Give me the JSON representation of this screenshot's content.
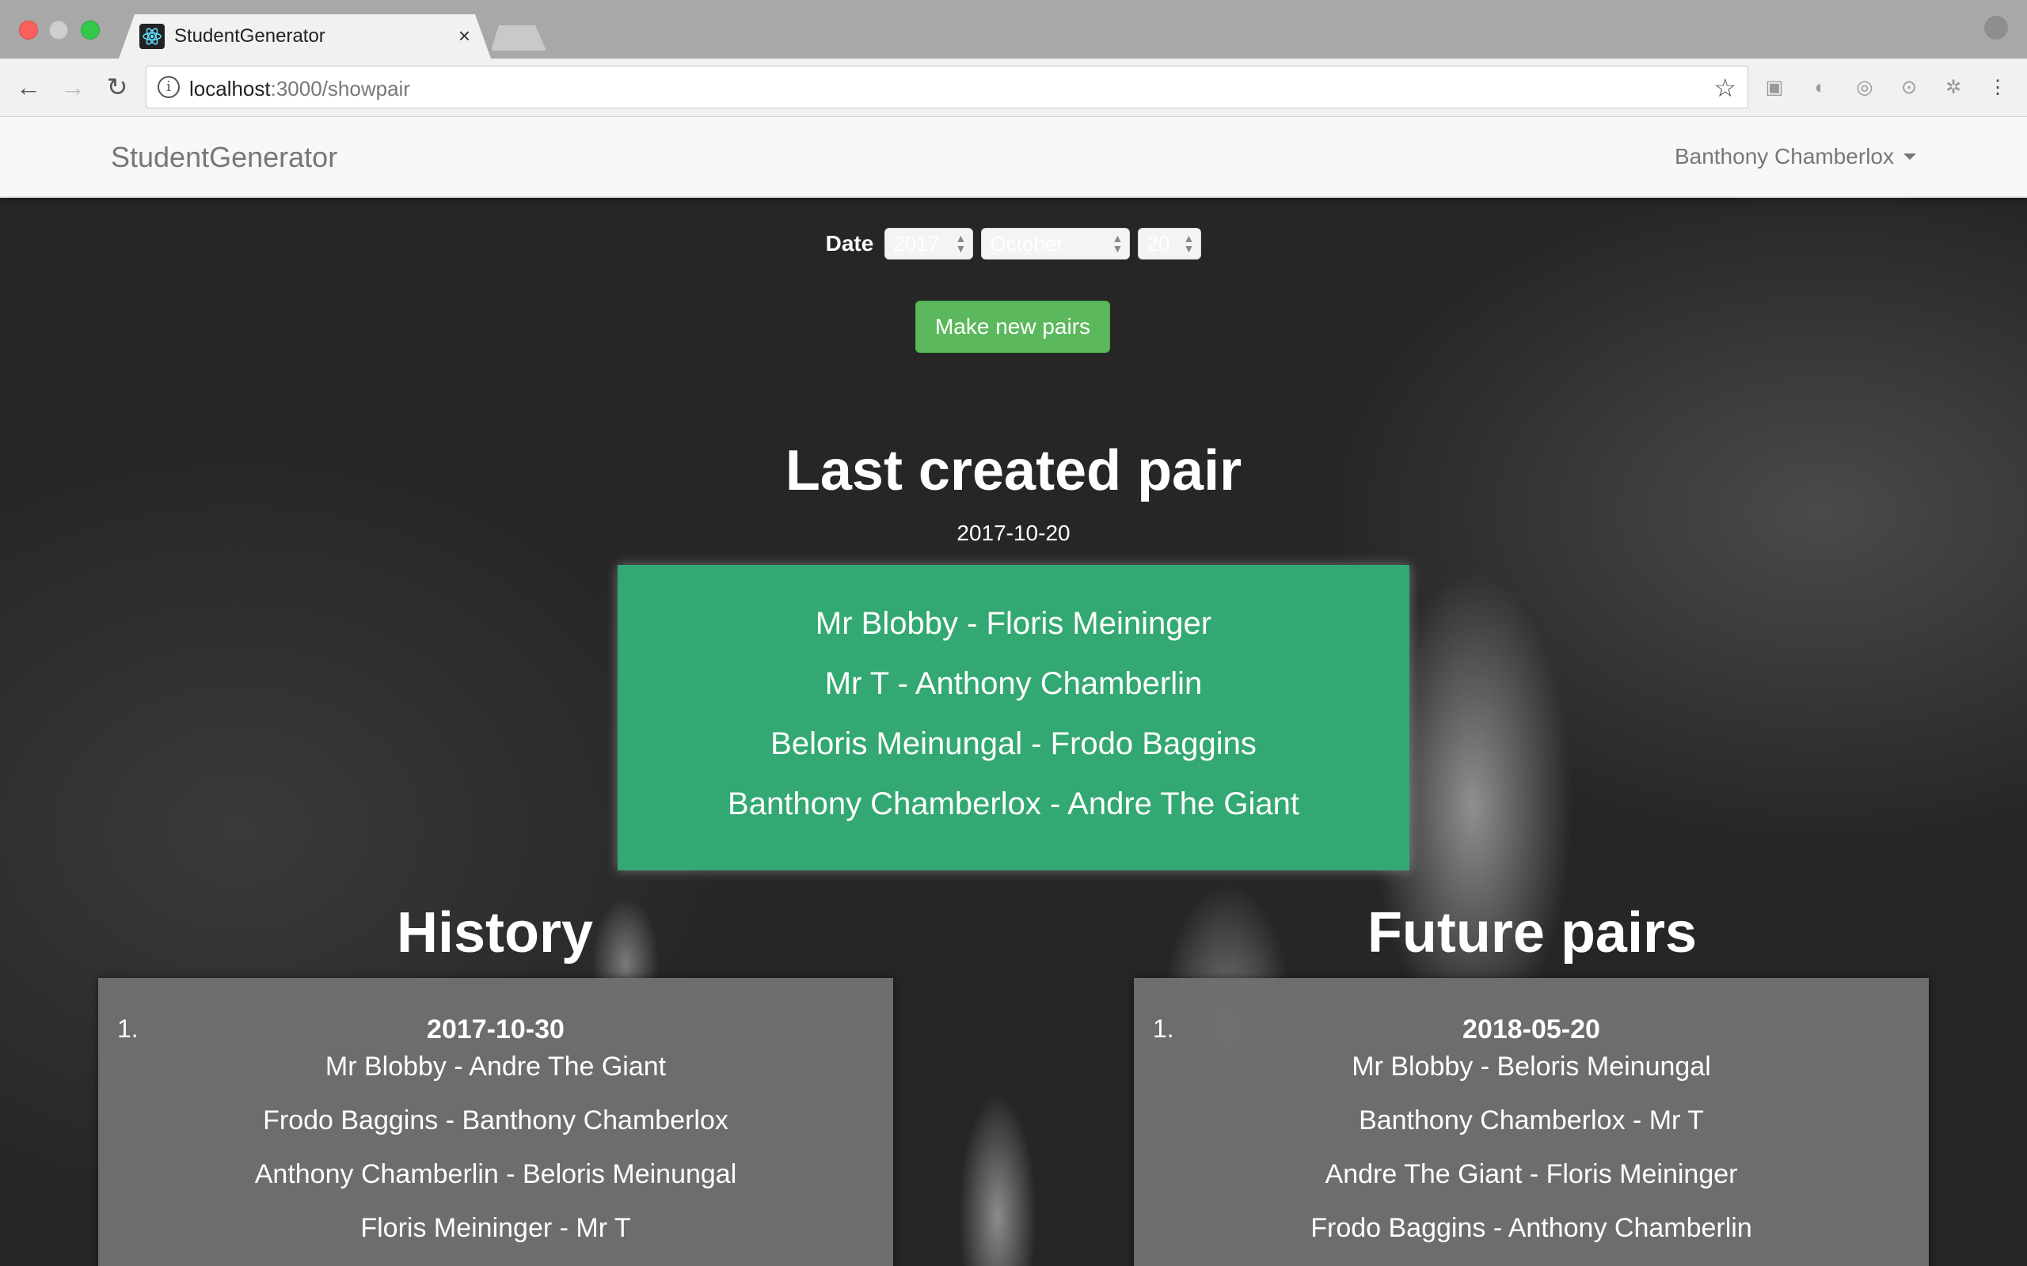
{
  "browser": {
    "tab_title": "StudentGenerator",
    "tab_close": "×",
    "url_host": "localhost",
    "url_path": ":3000/showpair"
  },
  "navbar": {
    "brand": "StudentGenerator",
    "user": "Banthony Chamberlox"
  },
  "date_picker": {
    "label": "Date",
    "year": "2017",
    "month": "October",
    "day": "20"
  },
  "make_button": "Make new pairs",
  "last_created": {
    "title": "Last created pair",
    "date": "2017-10-20",
    "pairs": [
      "Mr Blobby - Floris Meininger",
      "Mr T - Anthony Chamberlin",
      "Beloris Meinungal - Frodo Baggins",
      "Banthony Chamberlox - Andre The Giant"
    ]
  },
  "history": {
    "title": "History",
    "entries": [
      {
        "number": "1.",
        "date": "2017-10-30",
        "pairs": [
          "Mr Blobby - Andre The Giant",
          "Frodo Baggins - Banthony Chamberlox",
          "Anthony Chamberlin - Beloris Meinungal",
          "Floris Meininger - Mr T"
        ]
      }
    ]
  },
  "future": {
    "title": "Future pairs",
    "entries": [
      {
        "number": "1.",
        "date": "2018-05-20",
        "pairs": [
          "Mr Blobby - Beloris Meinungal",
          "Banthony Chamberlox - Mr T",
          "Andre The Giant - Floris Meininger",
          "Frodo Baggins - Anthony Chamberlin"
        ]
      }
    ]
  }
}
